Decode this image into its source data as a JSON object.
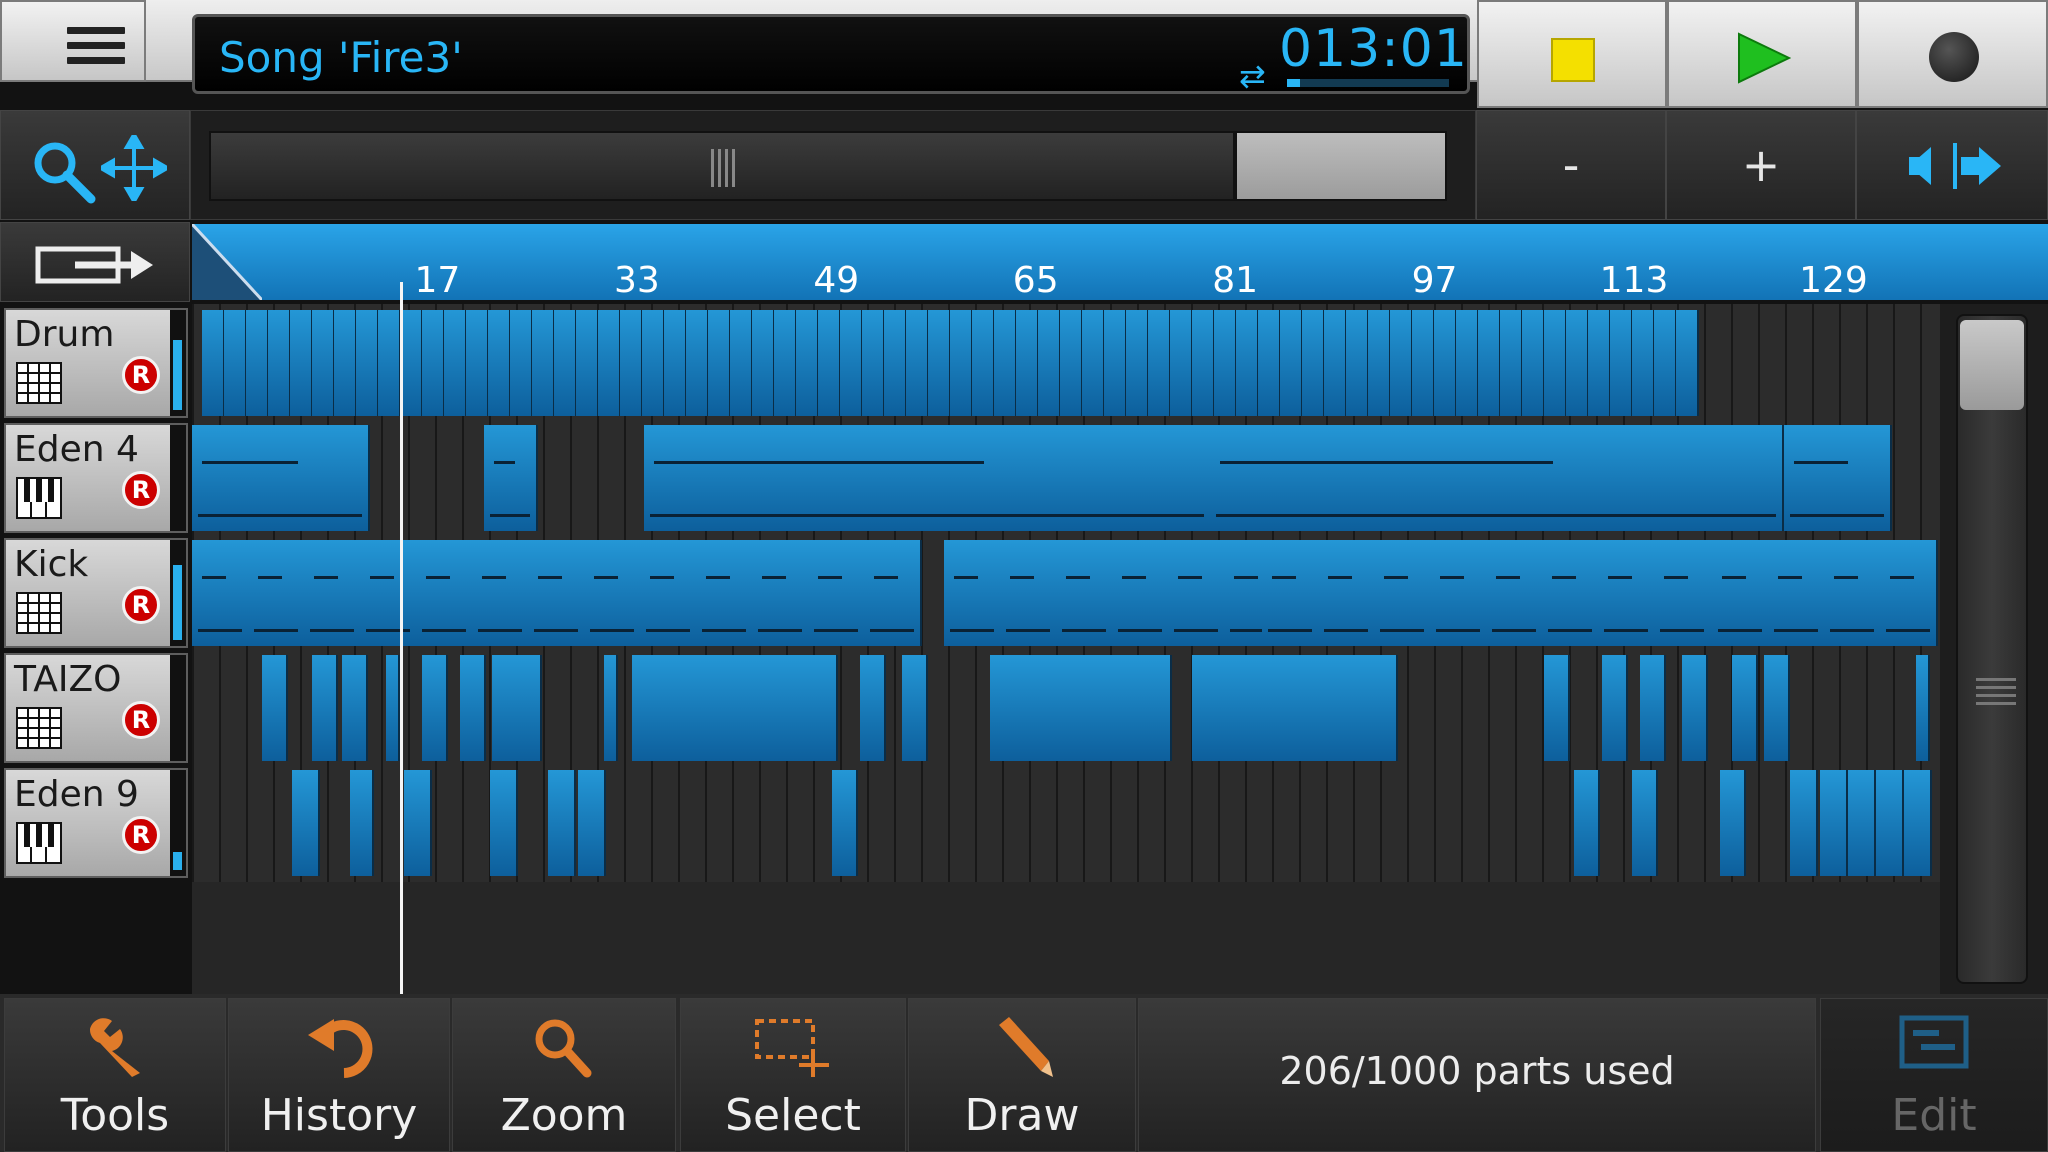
{
  "transport": {
    "song_title": "Song 'Fire3'",
    "position": "013:01",
    "position_progress": 0.08,
    "stop_label": "stop",
    "play_label": "play",
    "record_label": "record"
  },
  "zoom_bar": {
    "minus_label": "-",
    "plus_label": "+",
    "scroll_fraction": 0.83
  },
  "ruler": {
    "bar_labels": [
      "17",
      "33",
      "49",
      "65",
      "81",
      "97",
      "113",
      "129"
    ],
    "playhead_bar": 14
  },
  "tracks": [
    {
      "name": "Drum",
      "instrument_icon": "drum-pad-icon",
      "rec": "R",
      "level": 0.8
    },
    {
      "name": "Eden 4",
      "instrument_icon": "keyboard-icon",
      "rec": "R",
      "level": 0.0
    },
    {
      "name": "Kick",
      "instrument_icon": "drum-pad-icon",
      "rec": "R",
      "level": 0.85
    },
    {
      "name": "TAIZO",
      "instrument_icon": "drum-pad-icon",
      "rec": "R",
      "level": 0.0
    },
    {
      "name": "Eden 9",
      "instrument_icon": "keyboard-icon",
      "rec": "R",
      "level": 0.2
    }
  ],
  "toolbar": {
    "tools": "Tools",
    "history": "History",
    "zoom": "Zoom",
    "select": "Select",
    "draw": "Draw",
    "parts_used": "206/1000 parts used",
    "edit": "Edit"
  },
  "colors": {
    "accent": "#29b6f6",
    "part_fill": "#1a8fd0",
    "stop": "#f4e000",
    "play": "#1fbf1f",
    "record": "#222222",
    "icon_orange": "#e07b2a"
  }
}
